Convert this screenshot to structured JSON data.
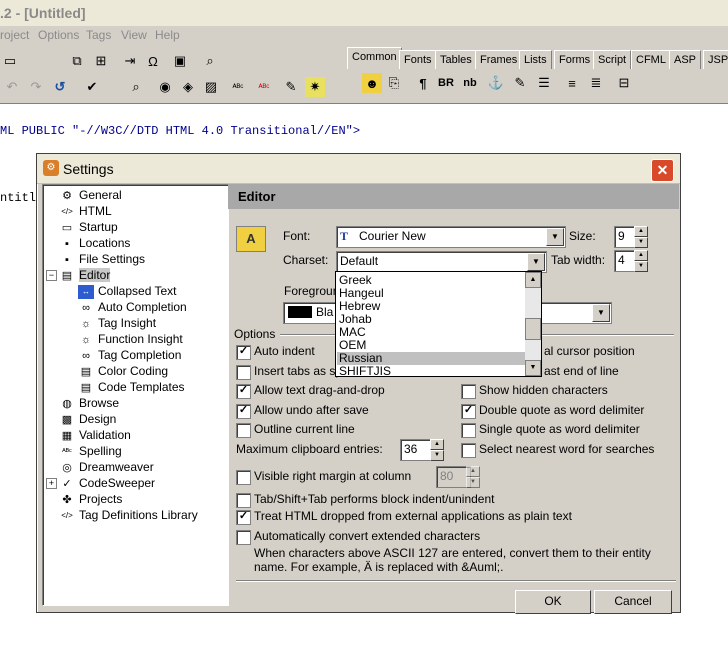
{
  "app": {
    "title": ".2 - [Untitled]",
    "menu": [
      "roject",
      "Options",
      "Tags",
      "View",
      "Help"
    ],
    "quickbar_tabs": [
      "Common",
      "Fonts",
      "Tables",
      "Frames",
      "Lists",
      "Forms",
      "Script",
      "CFML",
      "ASP",
      "JSP"
    ],
    "code_line": "ML PUBLIC \"-//W3C//DTD HTML 4.0 Transitional//EN\">",
    "code_left": "ntitle"
  },
  "dialog": {
    "title": "Settings",
    "close_label": "✕",
    "tree": [
      {
        "label": "General",
        "icon": "general-icon"
      },
      {
        "label": "HTML",
        "icon": "html-icon"
      },
      {
        "label": "Startup",
        "icon": "folder-icon"
      },
      {
        "label": "Locations",
        "icon": "disk-icon"
      },
      {
        "label": "File Settings",
        "icon": "disk-icon"
      },
      {
        "label": "Editor",
        "icon": "document-icon"
      },
      {
        "label": "Collapsed Text",
        "icon": "collapse-icon"
      },
      {
        "label": "Auto Completion",
        "icon": "glasses-icon"
      },
      {
        "label": "Tag Insight",
        "icon": "bulb-icon"
      },
      {
        "label": "Function Insight",
        "icon": "bulb-icon"
      },
      {
        "label": "Tag Completion",
        "icon": "glasses-icon"
      },
      {
        "label": "Color Coding",
        "icon": "document-icon"
      },
      {
        "label": "Code Templates",
        "icon": "document-icon"
      },
      {
        "label": "Browse",
        "icon": "browse-icon"
      },
      {
        "label": "Design",
        "icon": "design-icon"
      },
      {
        "label": "Validation",
        "icon": "validation-icon"
      },
      {
        "label": "Spelling",
        "icon": "spelling-icon"
      },
      {
        "label": "Dreamweaver",
        "icon": "dreamweaver-icon"
      },
      {
        "label": "CodeSweeper",
        "icon": "broom-icon"
      },
      {
        "label": "Projects",
        "icon": "projects-icon"
      },
      {
        "label": "Tag Definitions Library",
        "icon": "tag-library-icon"
      }
    ],
    "panel_title": "Editor",
    "font_label": "Font:",
    "font_value": "Courier New",
    "size_label": "Size:",
    "size_value": "9",
    "charset_label": "Charset:",
    "charset_value": "Default",
    "tab_width_label": "Tab width:",
    "tab_width_value": "4",
    "foreground_label": "Foregroun",
    "foreground_value": "Bla",
    "charset_options": [
      "Greek",
      "Hangeul",
      "Hebrew",
      "Johab",
      "MAC",
      "OEM",
      "Russian",
      "SHIFTJIS"
    ],
    "charset_highlight": "Russian",
    "options_label": "Options",
    "left_options": [
      {
        "label": "Auto indent",
        "checked": true
      },
      {
        "label": "Insert tabs as spa",
        "checked": false
      },
      {
        "label": "Allow text drag-and-drop",
        "checked": true
      },
      {
        "label": "Allow undo after save",
        "checked": true
      },
      {
        "label": "Outline current line",
        "checked": false
      }
    ],
    "right_options": [
      {
        "label": "al cursor position",
        "checked": null
      },
      {
        "label": "ast end of line",
        "checked": null
      },
      {
        "label": "Show hidden characters",
        "checked": false
      },
      {
        "label": "Double quote as word delimiter",
        "checked": true
      },
      {
        "label": "Single quote as word delimiter",
        "checked": false
      },
      {
        "label": "Select nearest word for searches",
        "checked": false
      }
    ],
    "clipboard_label": "Maximum clipboard entries:",
    "clipboard_value": "36",
    "right_margin_label": "Visible right margin at column",
    "right_margin_checked": false,
    "right_margin_value": "80",
    "bottom_options": [
      {
        "label": "Tab/Shift+Tab performs block indent/unindent",
        "checked": false
      },
      {
        "label": "Treat HTML dropped from external applications as plain text",
        "checked": true
      },
      {
        "label": "Automatically convert extended characters",
        "checked": false
      }
    ],
    "convert_note_1": "When characters above ASCII 127 are entered, convert them to their entity",
    "convert_note_2": "name.  For example,  Ä is replaced with &Auml;.",
    "ok_label": "OK",
    "cancel_label": "Cancel"
  }
}
